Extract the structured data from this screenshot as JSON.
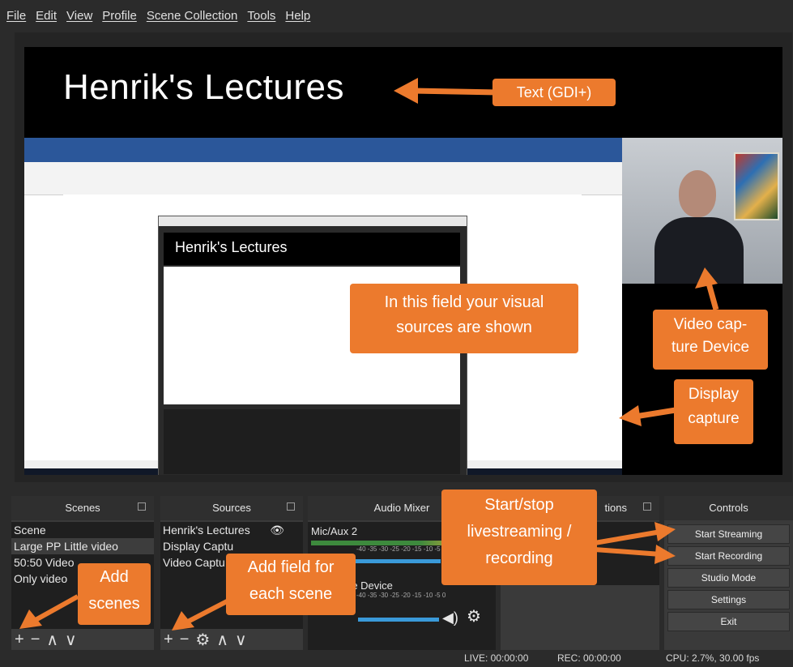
{
  "menu": [
    "File",
    "Edit",
    "View",
    "Profile",
    "Scene Collection",
    "Tools",
    "Help"
  ],
  "preview": {
    "title_text": "Henrik's Lectures",
    "inner_title": "Henrik's Lectures"
  },
  "annotations": {
    "text_gdi": "Text (GDI+)",
    "visual_sources_1": "In this field your visual",
    "visual_sources_2": "sources are shown",
    "video_capture_1": "Video cap-",
    "video_capture_2": "ture Device",
    "display_capture_1": "Display",
    "display_capture_2": "capture",
    "start_stop_1": "Start/stop",
    "start_stop_2": "livestreaming /",
    "start_stop_3": "recording",
    "add_field_1": "Add field for",
    "add_field_2": "each scene",
    "add_scenes_1": "Add",
    "add_scenes_2": "scenes"
  },
  "docks": {
    "scenes": {
      "title": "Scenes",
      "items": [
        "Scene",
        "Large PP Little video",
        "50:50 Video",
        "Only video"
      ],
      "selected": 1
    },
    "sources": {
      "title": "Sources",
      "items": [
        "Henrik's Lectures",
        "Display Captu",
        "Video Captu"
      ]
    },
    "audio": {
      "title": "Audio Mixer",
      "channels": [
        {
          "name": "Mic/Aux 2",
          "ticks": "-40  -35  -30  -25  -20  -15  -10   -5    0"
        },
        {
          "name": "re Device",
          "ticks": "-40  -35  -30  -25  -20  -15  -10   -5    0"
        }
      ]
    },
    "transitions": {
      "title": "tions"
    },
    "controls": {
      "title": "Controls",
      "buttons": [
        "Start Streaming",
        "Start Recording",
        "Studio Mode",
        "Settings",
        "Exit"
      ]
    }
  },
  "status": {
    "live": "LIVE: 00:00:00",
    "rec": "REC: 00:00:00",
    "cpu": "CPU: 2.7%, 30.00 fps"
  },
  "colors": {
    "accent": "#ec7a2d",
    "panel": "#3a3a3a",
    "background": "#2b2b2b"
  }
}
